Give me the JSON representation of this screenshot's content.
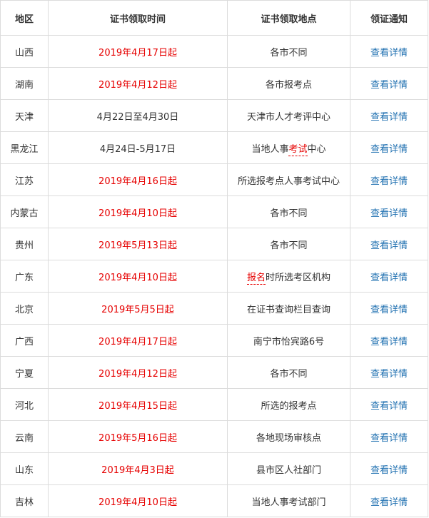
{
  "table": {
    "headers": [
      "地区",
      "证书领取时间",
      "证书领取地点",
      "领证通知"
    ],
    "rows": [
      {
        "region": "山西",
        "time": "2019年4月17日起",
        "time_color": "#e60000",
        "place_pre": "各市不同",
        "place_kw": "",
        "place_post": "",
        "notice": "查看详情"
      },
      {
        "region": "湖南",
        "time": "2019年4月12日起",
        "time_color": "#e60000",
        "place_pre": "各市报考点",
        "place_kw": "",
        "place_post": "",
        "notice": "查看详情"
      },
      {
        "region": "天津",
        "time": "4月22日至4月30日",
        "time_color": "#333333",
        "place_pre": "天津市人才考评中心",
        "place_kw": "",
        "place_post": "",
        "notice": "查看详情"
      },
      {
        "region": "黑龙江",
        "time": "4月24日-5月17日",
        "time_color": "#333333",
        "place_pre": "当地人事",
        "place_kw": "考试",
        "place_post": "中心",
        "notice": "查看详情"
      },
      {
        "region": "江苏",
        "time": "2019年4月16日起",
        "time_color": "#e60000",
        "place_pre": "所选报考点人事考试中心",
        "place_kw": "",
        "place_post": "",
        "notice": "查看详情"
      },
      {
        "region": "内蒙古",
        "time": "2019年4月10日起",
        "time_color": "#e60000",
        "place_pre": "各市不同",
        "place_kw": "",
        "place_post": "",
        "notice": "查看详情"
      },
      {
        "region": "贵州",
        "time": "2019年5月13日起",
        "time_color": "#e60000",
        "place_pre": "各市不同",
        "place_kw": "",
        "place_post": "",
        "notice": "查看详情"
      },
      {
        "region": "广东",
        "time": "2019年4月10日起",
        "time_color": "#e60000",
        "place_pre": "",
        "place_kw": "报名",
        "place_post": "时所选考区机构",
        "notice": "查看详情"
      },
      {
        "region": "北京",
        "time": "2019年5月5日起",
        "time_color": "#e60000",
        "place_pre": "在证书查询栏目查询",
        "place_kw": "",
        "place_post": "",
        "notice": "查看详情"
      },
      {
        "region": "广西",
        "time": "2019年4月17日起",
        "time_color": "#e60000",
        "place_pre": "南宁市怡宾路6号",
        "place_kw": "",
        "place_post": "",
        "notice": "查看详情"
      },
      {
        "region": "宁夏",
        "time": "2019年4月12日起",
        "time_color": "#e60000",
        "place_pre": "各市不同",
        "place_kw": "",
        "place_post": "",
        "notice": "查看详情"
      },
      {
        "region": "河北",
        "time": "2019年4月15日起",
        "time_color": "#e60000",
        "place_pre": "所选的报考点",
        "place_kw": "",
        "place_post": "",
        "notice": "查看详情"
      },
      {
        "region": "云南",
        "time": "2019年5月16日起",
        "time_color": "#e60000",
        "place_pre": "各地现场审核点",
        "place_kw": "",
        "place_post": "",
        "notice": "查看详情"
      },
      {
        "region": "山东",
        "time": "2019年4月3日起",
        "time_color": "#e60000",
        "place_pre": "县市区人社部门",
        "place_kw": "",
        "place_post": "",
        "notice": "查看详情"
      },
      {
        "region": "吉林",
        "time": "2019年4月10日起",
        "time_color": "#e60000",
        "place_pre": "当地人事考试部门",
        "place_kw": "",
        "place_post": "",
        "notice": "查看详情"
      }
    ]
  }
}
